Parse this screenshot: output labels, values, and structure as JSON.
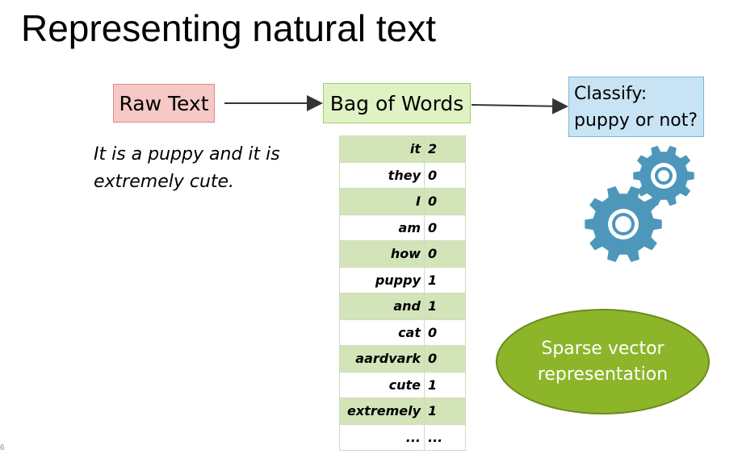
{
  "title": "Representing natural text",
  "raw_text_label": "Raw Text",
  "bag_of_words_label": "Bag of Words",
  "classify": {
    "line1": "Classify:",
    "line2": "puppy or not?"
  },
  "sentence": {
    "line1": "It is a puppy and it is",
    "line2": "extremely cute."
  },
  "bag_table": [
    {
      "word": "it",
      "count": "2"
    },
    {
      "word": "they",
      "count": "0"
    },
    {
      "word": "I",
      "count": "0"
    },
    {
      "word": "am",
      "count": "0"
    },
    {
      "word": "how",
      "count": "0"
    },
    {
      "word": "puppy",
      "count": "1"
    },
    {
      "word": "and",
      "count": "1"
    },
    {
      "word": "cat",
      "count": "0"
    },
    {
      "word": "aardvark",
      "count": "0"
    },
    {
      "word": "cute",
      "count": "1"
    },
    {
      "word": "extremely",
      "count": "1"
    },
    {
      "word": "...",
      "count": "..."
    }
  ],
  "sparse_vector": {
    "line1": "Sparse vector",
    "line2": "representation"
  },
  "page_number": "6",
  "icons": {
    "gears": "gears-icon"
  },
  "colors": {
    "raw_fill": "#f6c8c6",
    "bow_fill": "#dff2c4",
    "classify_fill": "#c8e4f4",
    "gear_color": "#4d97ba",
    "ellipse_fill": "#8db52a",
    "table_stripe": "#d3e4b8"
  }
}
